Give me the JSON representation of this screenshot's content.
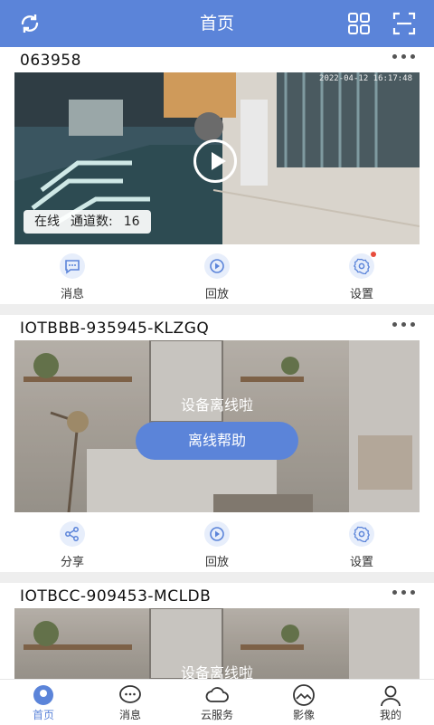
{
  "header": {
    "title": "首页",
    "refresh_icon": "refresh-icon",
    "grid_icon": "grid-icon",
    "scan_icon": "scan-icon"
  },
  "devices": [
    {
      "name": "063958",
      "timestamp": "2022-04-12 16:17:48",
      "status": "在线",
      "channels_label": "通道数:",
      "channels": "16",
      "actions": [
        {
          "label": "消息",
          "icon": "message-icon"
        },
        {
          "label": "回放",
          "icon": "playback-icon"
        },
        {
          "label": "设置",
          "icon": "settings-icon"
        }
      ]
    },
    {
      "name": "IOTBBB-935945-KLZGQ",
      "offline_text": "设备离线啦",
      "help_button": "离线帮助",
      "actions": [
        {
          "label": "分享",
          "icon": "share-icon"
        },
        {
          "label": "回放",
          "icon": "playback-icon"
        },
        {
          "label": "设置",
          "icon": "settings-icon"
        }
      ]
    },
    {
      "name": "IOTBCC-909453-MCLDB",
      "offline_text": "设备离线啦"
    }
  ],
  "nav": [
    {
      "label": "首页",
      "icon": "home-icon",
      "active": true
    },
    {
      "label": "消息",
      "icon": "chat-icon"
    },
    {
      "label": "云服务",
      "icon": "cloud-icon"
    },
    {
      "label": "影像",
      "icon": "image-icon"
    },
    {
      "label": "我的",
      "icon": "profile-icon"
    }
  ],
  "colors": {
    "primary": "#5b84d9",
    "badge": "#e74c3c"
  }
}
